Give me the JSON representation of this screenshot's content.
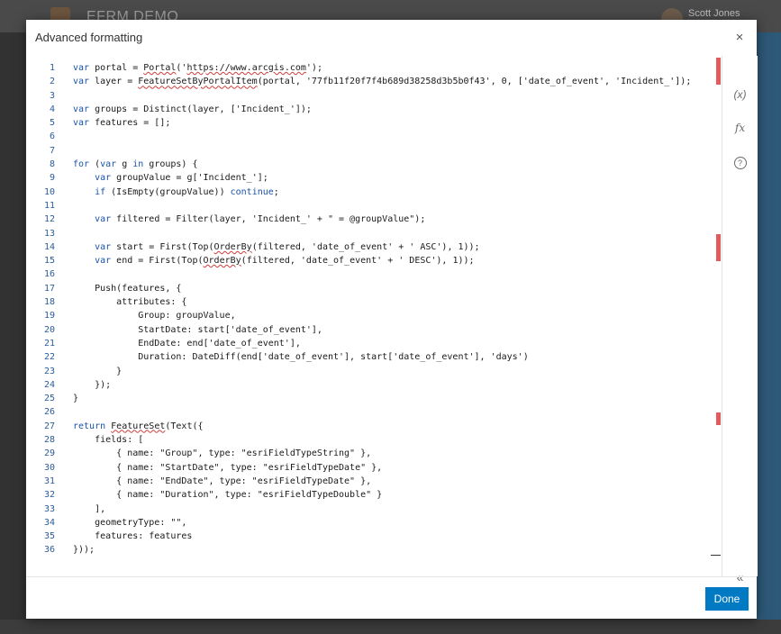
{
  "background": {
    "app_title": "EFRM DEMO",
    "user_name": "Scott Jones"
  },
  "dialog": {
    "title": "Advanced formatting",
    "close_icon": "×",
    "done_label": "Done"
  },
  "tools": {
    "variables_icon": "(x)",
    "functions_icon": "fx",
    "help_icon": "?",
    "collapse_icon": "«"
  },
  "editor": {
    "line_numbers": [
      "1",
      "2",
      "3",
      "4",
      "5",
      "6",
      "7",
      "8",
      "9",
      "10",
      "11",
      "12",
      "13",
      "14",
      "15",
      "16",
      "17",
      "18",
      "19",
      "20",
      "21",
      "22",
      "23",
      "24",
      "25",
      "26",
      "27",
      "28",
      "29",
      "30",
      "31",
      "32",
      "33",
      "34",
      "35",
      "36"
    ]
  },
  "colors": {
    "accent": "#007ac2",
    "error": "#e25b5b",
    "keyword": "#1a52a8"
  }
}
